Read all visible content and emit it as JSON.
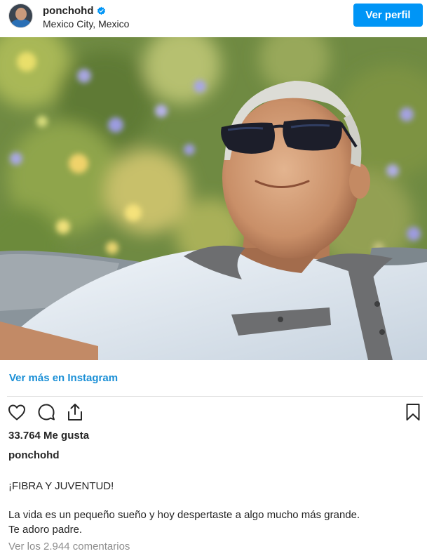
{
  "header": {
    "username": "ponchohd",
    "location": "Mexico City, Mexico",
    "profile_button": "Ver perfil",
    "verified_icon": "verified-badge-icon"
  },
  "post": {
    "more_link": "Ver más en Instagram",
    "likes": "33.764 Me gusta",
    "caption_username": "ponchohd",
    "caption_lines": [
      "¡FIBRA Y JUVENTUD!",
      "La vida es un pequeño sueño y hoy despertaste a algo mucho más grande.",
      "Te adoro padre."
    ],
    "comments_link": "Ver los 2.944 comentarios"
  },
  "actions": {
    "icons": [
      "heart-icon",
      "comment-icon",
      "share-icon",
      "bookmark-icon"
    ]
  },
  "colors": {
    "accent": "#0095f6",
    "link": "#1a8fd6",
    "text": "#262626",
    "muted": "#8e8e8e"
  }
}
